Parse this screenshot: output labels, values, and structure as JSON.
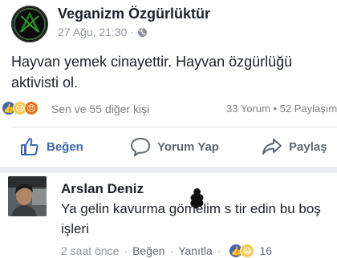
{
  "post": {
    "page_name": "Veganizm Özgürlüktür",
    "timestamp": "27 Ağu, 21:30",
    "separator": "·",
    "text": "Hayvan yemek cinayettir. Hayvan özgürlüğü aktivisti ol."
  },
  "reactions": {
    "icons": [
      "like-reaction",
      "sad-reaction",
      "angry-reaction"
    ],
    "label": "Sen ve 55 diğer kişi",
    "counts": "33 Yorum • 52 Paylaşım"
  },
  "actions": {
    "like": "Beğen",
    "comment": "Yorum Yap",
    "share": "Paylaş"
  },
  "comment": {
    "author": "Arslan Deniz",
    "text": "Ya gelin kavurma gömelim s  tir edin bu boş işleri",
    "time": "2 saat önce",
    "like": "Beğen",
    "reply": "Yanıtla",
    "sep": "·",
    "reaction_count": "16"
  },
  "colors": {
    "facebook_blue": "#4267b2",
    "meta_gray": "#90949c",
    "text": "#1d2129"
  }
}
